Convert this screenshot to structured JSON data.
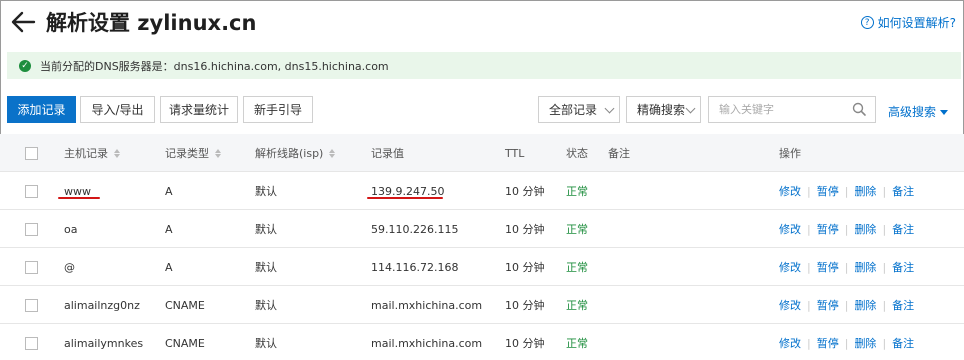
{
  "header": {
    "title": "解析设置 zylinux.cn",
    "help_label": "如何设置解析?",
    "help_icon": "question-circle-icon"
  },
  "dns_banner": {
    "text": "当前分配的DNS服务器是：dns16.hichina.com, dns15.hichina.com",
    "icon": "check-circle-icon"
  },
  "toolbar": {
    "add_record": "添加记录",
    "import_export": "导入/导出",
    "request_stats": "请求量统计",
    "beginner_guide": "新手引导",
    "record_filter": "全部记录",
    "search_mode": "精确搜索",
    "search_placeholder": "输入关键字",
    "advanced_search": "高级搜索"
  },
  "table": {
    "columns": {
      "host": "主机记录",
      "type": "记录类型",
      "line": "解析线路(isp)",
      "value": "记录值",
      "ttl": "TTL",
      "status": "状态",
      "remark": "备注",
      "actions": "操作"
    },
    "rows": [
      {
        "host": "www",
        "type": "A",
        "line": "默认",
        "value": "139.9.247.50",
        "ttl": "10 分钟",
        "status": "正常",
        "remark": "",
        "a1": "修改",
        "a2": "暂停",
        "a3": "删除",
        "a4": "备注"
      },
      {
        "host": "oa",
        "type": "A",
        "line": "默认",
        "value": "59.110.226.115",
        "ttl": "10 分钟",
        "status": "正常",
        "remark": "",
        "a1": "修改",
        "a2": "暂停",
        "a3": "删除",
        "a4": "备注"
      },
      {
        "host": "@",
        "type": "A",
        "line": "默认",
        "value": "114.116.72.168",
        "ttl": "10 分钟",
        "status": "正常",
        "remark": "",
        "a1": "修改",
        "a2": "暂停",
        "a3": "删除",
        "a4": "备注"
      },
      {
        "host": "alimailnzg0nz",
        "type": "CNAME",
        "line": "默认",
        "value": "mail.mxhichina.com",
        "ttl": "10 分钟",
        "status": "正常",
        "remark": "",
        "a1": "修改",
        "a2": "暂停",
        "a3": "删除",
        "a4": "备注"
      },
      {
        "host": "alimailymnkes",
        "type": "CNAME",
        "line": "默认",
        "value": "mail.mxhichina.com",
        "ttl": "10 分钟",
        "status": "正常",
        "remark": "",
        "a1": "修改",
        "a2": "暂停",
        "a3": "删除",
        "a4": "备注"
      }
    ]
  },
  "colors": {
    "primary": "#0a72c9",
    "link": "#0070cc",
    "success": "#1e8e3e",
    "banner_bg": "#e9f6ea",
    "annotation_red": "#d31616"
  }
}
